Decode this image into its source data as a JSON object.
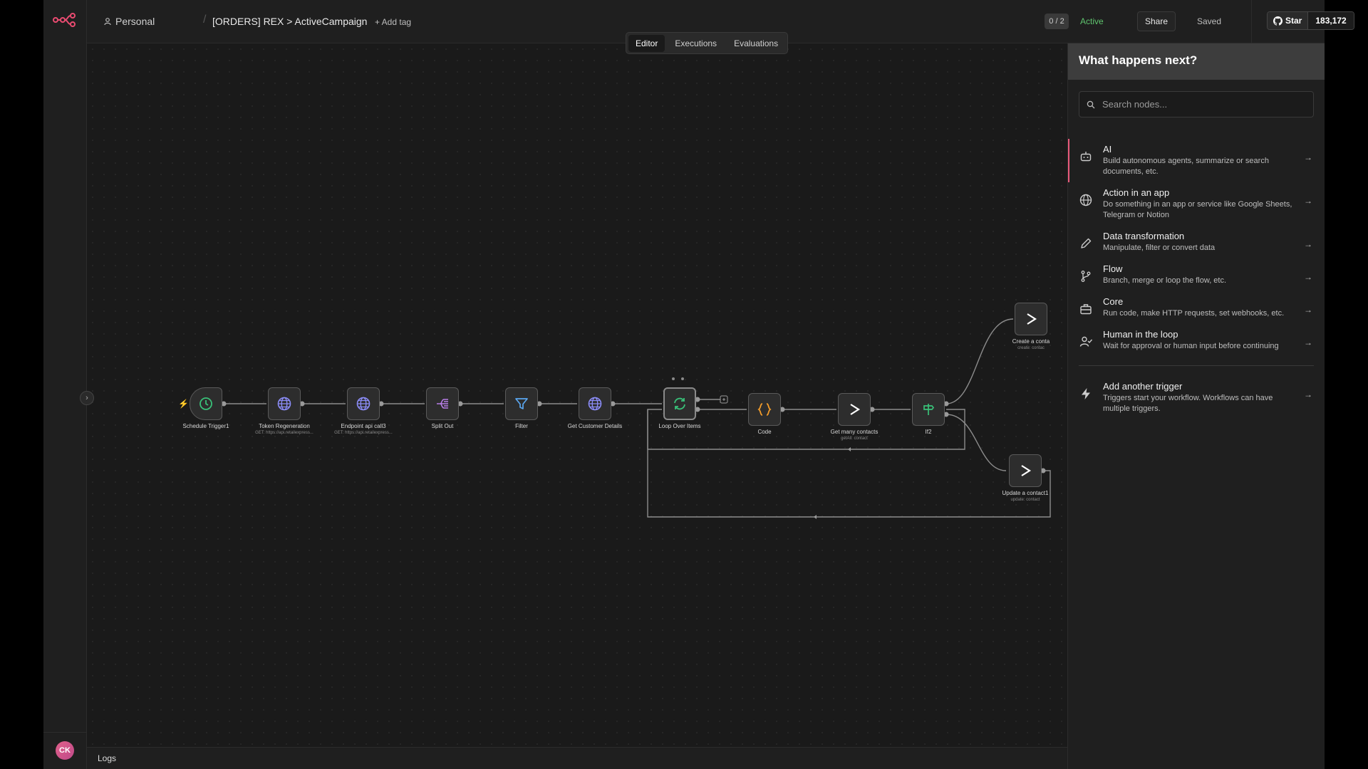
{
  "header": {
    "project": "Personal",
    "workflow_name": "[ORDERS] REX > ActiveCampaign",
    "add_tag": "+ Add tag",
    "counter": "0 / 2",
    "status": "Active",
    "share": "Share",
    "saved": "Saved",
    "github_star": "Star",
    "github_count": "183,172"
  },
  "tabs": [
    "Editor",
    "Executions",
    "Evaluations"
  ],
  "user": {
    "initials": "CK"
  },
  "logs": "Logs",
  "nodes": [
    {
      "label": "Schedule Trigger1",
      "sub": ""
    },
    {
      "label": "Token Regeneration",
      "sub": "GET: https://api.retailexpress..."
    },
    {
      "label": "Endpoint api call3",
      "sub": "GET: https://api.retailexpress..."
    },
    {
      "label": "Split Out",
      "sub": ""
    },
    {
      "label": "Filter",
      "sub": ""
    },
    {
      "label": "Get Customer Details",
      "sub": ""
    },
    {
      "label": "Loop Over Items",
      "sub": ""
    },
    {
      "label": "Code",
      "sub": ""
    },
    {
      "label": "Get many contacts",
      "sub": "getAll: contact"
    },
    {
      "label": "If2",
      "sub": ""
    },
    {
      "label": "Create a conta",
      "sub": "create: contac"
    },
    {
      "label": "Update a contact1",
      "sub": "update: contact"
    }
  ],
  "panel": {
    "title": "What happens next?",
    "search_placeholder": "Search nodes...",
    "categories": [
      {
        "title": "AI",
        "desc": "Build autonomous agents, summarize or search documents, etc.",
        "icon": "robot-icon"
      },
      {
        "title": "Action in an app",
        "desc": "Do something in an app or service like Google Sheets, Telegram or Notion",
        "icon": "globe-icon"
      },
      {
        "title": "Data transformation",
        "desc": "Manipulate, filter or convert data",
        "icon": "pen-icon"
      },
      {
        "title": "Flow",
        "desc": "Branch, merge or loop the flow, etc.",
        "icon": "branch-icon"
      },
      {
        "title": "Core",
        "desc": "Run code, make HTTP requests, set webhooks, etc.",
        "icon": "toolbox-icon"
      },
      {
        "title": "Human in the loop",
        "desc": "Wait for approval or human input before continuing",
        "icon": "user-check-icon"
      }
    ],
    "trigger": {
      "title": "Add another trigger",
      "desc": "Triggers start your workflow. Workflows can have multiple triggers.",
      "icon": "bolt-icon"
    }
  }
}
